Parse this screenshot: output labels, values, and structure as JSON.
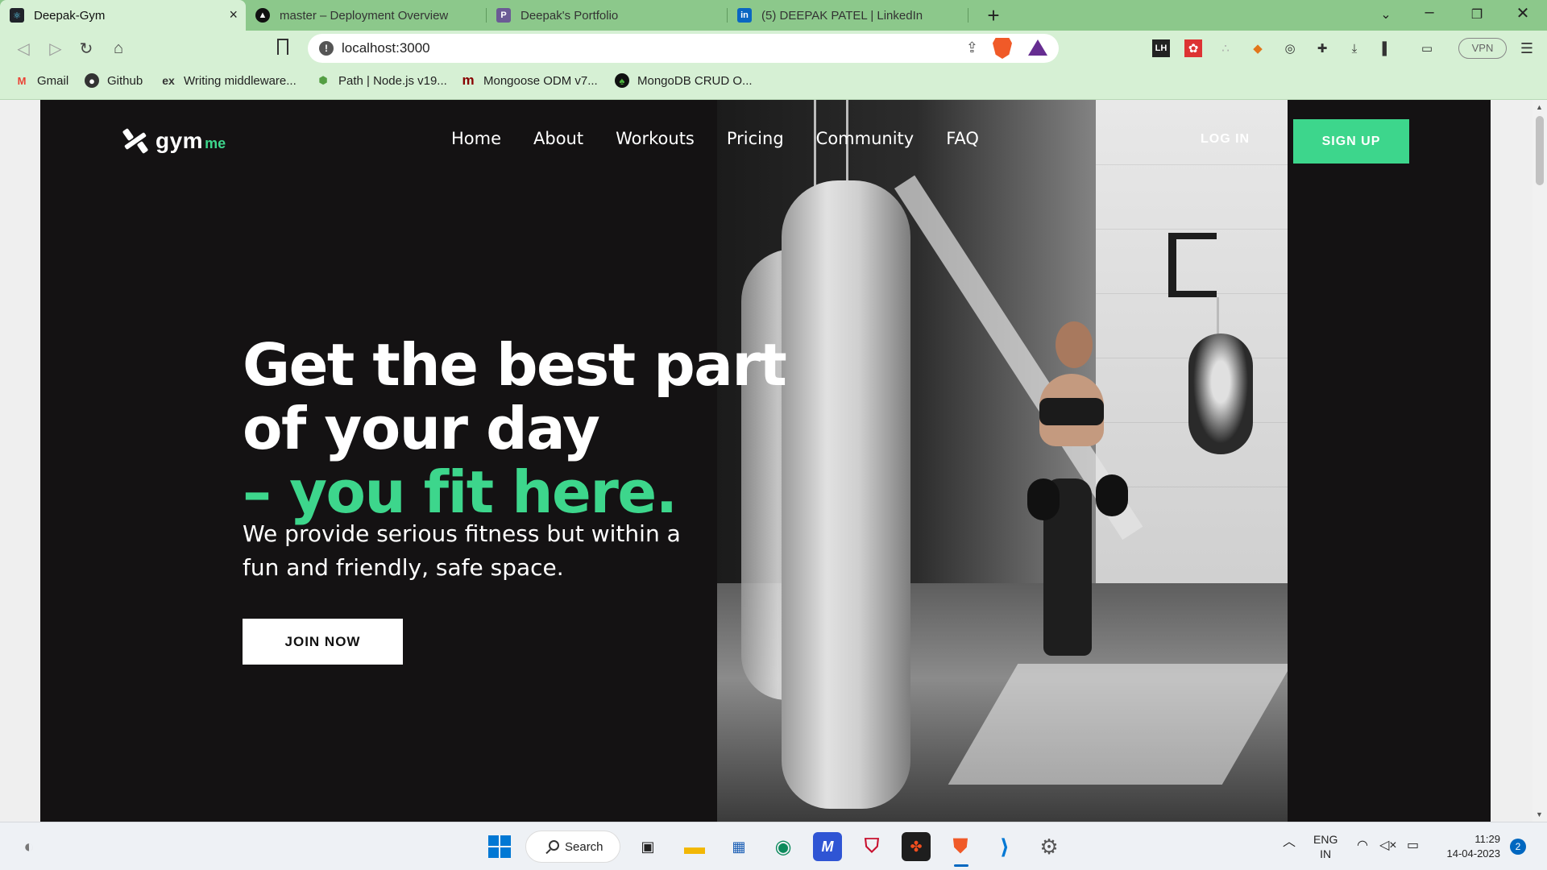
{
  "browser": {
    "tabs": [
      {
        "label": "Deepak-Gym",
        "active": true,
        "icon": "react-icon"
      },
      {
        "label": "master – Deployment Overview",
        "active": false,
        "icon": "vercel-icon"
      },
      {
        "label": "Deepak's Portfolio",
        "active": false,
        "icon": "portfolio-icon"
      },
      {
        "label": "(5) DEEPAK PATEL | LinkedIn",
        "active": false,
        "icon": "linkedin-icon"
      }
    ],
    "address": "localhost:3000",
    "vpn_label": "VPN",
    "bookmarks": [
      {
        "label": "Gmail",
        "icon": "gmail-icon"
      },
      {
        "label": "Github",
        "icon": "github-icon"
      },
      {
        "label": "Writing middleware...",
        "icon": "express-icon"
      },
      {
        "label": "Path | Node.js v19...",
        "icon": "nodejs-icon"
      },
      {
        "label": "Mongoose ODM v7...",
        "icon": "mongoose-icon"
      },
      {
        "label": "MongoDB CRUD O...",
        "icon": "mongodb-icon"
      }
    ]
  },
  "site": {
    "logo": {
      "main": "gym",
      "suffix": "me"
    },
    "nav": [
      "Home",
      "About",
      "Workouts",
      "Pricing",
      "Community",
      "FAQ"
    ],
    "login_label": "LOG IN",
    "signup_label": "SIGN UP",
    "hero": {
      "line1": "Get the best part",
      "line2": "of your day",
      "accent": "– you fit here.",
      "subtitle": "We provide serious fitness but within a fun and friendly, safe space.",
      "cta": "JOIN NOW"
    },
    "colors": {
      "accent": "#3dd68c",
      "background": "#141213"
    }
  },
  "taskbar": {
    "search_label": "Search",
    "language": "ENG",
    "region": "IN",
    "time": "11:29",
    "date": "14-04-2023",
    "notifications": "2"
  }
}
